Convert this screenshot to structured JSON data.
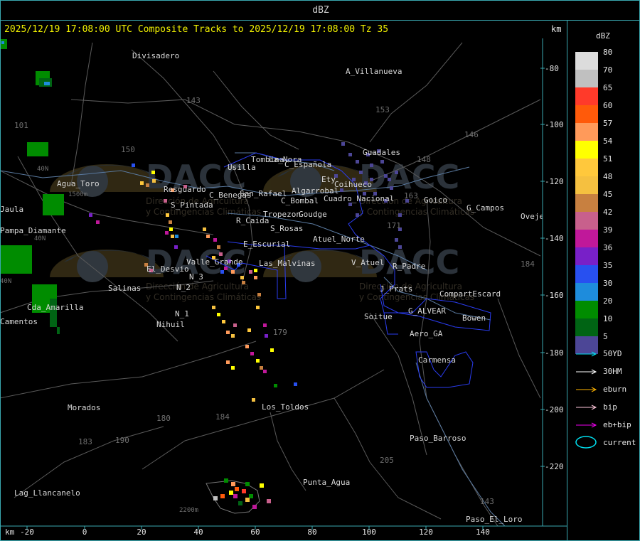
{
  "window": {
    "title": "dBZ"
  },
  "header": {
    "text": "2025/12/19 17:08:00 UTC Composite Tracks to 2025/12/19 17:08:00 Tz 35",
    "km_label": "km"
  },
  "axes": {
    "x_label": "km",
    "x_ticks": [
      "-20",
      "0",
      "20",
      "40",
      "60",
      "80",
      "100",
      "120",
      "140"
    ],
    "y_ticks": [
      "-80",
      "-100",
      "-120",
      "-140",
      "-160",
      "-180",
      "-200",
      "-220"
    ]
  },
  "legend": {
    "title": "dBZ",
    "levels": [
      {
        "label": "80",
        "color": "#dcdcdc"
      },
      {
        "label": "70",
        "color": "#c0c0c0"
      },
      {
        "label": "65",
        "color": "#ff3a2a"
      },
      {
        "label": "60",
        "color": "#ff5a0a"
      },
      {
        "label": "57",
        "color": "#ff9a5a"
      },
      {
        "label": "54",
        "color": "#ffff00"
      },
      {
        "label": "51",
        "color": "#ffc83c"
      },
      {
        "label": "48",
        "color": "#f5c040"
      },
      {
        "label": "45",
        "color": "#c88040"
      },
      {
        "label": "42",
        "color": "#c8608c"
      },
      {
        "label": "39",
        "color": "#c0189a"
      },
      {
        "label": "36",
        "color": "#7820c8"
      },
      {
        "label": "35",
        "color": "#2850f0"
      },
      {
        "label": "30",
        "color": "#1e8cdc"
      },
      {
        "label": "20",
        "color": "#008c00"
      },
      {
        "label": "10",
        "color": "#006414"
      },
      {
        "label": "5",
        "color": "#4c4696"
      }
    ],
    "tracks": [
      {
        "label": "50YD",
        "color": "#00e0f0"
      },
      {
        "label": "30HM",
        "color": "#ffffff"
      },
      {
        "label": "eburn",
        "color": "#ffb400"
      },
      {
        "label": "bip",
        "color": "#ffc8dc"
      },
      {
        "label": "eb+bip",
        "color": "#f000f0"
      }
    ],
    "current_label": "current",
    "current_color": "#00e0f0"
  },
  "map": {
    "watermarks": [
      {
        "brand": "DACC",
        "line1": "Dirección de Agricultura",
        "line2": "y Contingencias Climáticas"
      }
    ],
    "places": [
      "Divisadero",
      "A_Villanueva",
      "Guadales",
      "La_Nora",
      "C_Española",
      "Usilla",
      "Tombina",
      "San_Rafael",
      "C_Benegas",
      "C_Bombal",
      "Algarrobal",
      "Tropezon",
      "Goudge",
      "Cuadro_Nacional",
      "Resguardo",
      "S_Pintada",
      "R_Caida",
      "S_Rosas",
      "Atuel_Norte",
      "E_Escurial",
      "Valle_Grande",
      "El_Desvio",
      "Las_Malvinas",
      "V_Atuel",
      "R_Padre",
      "J_Prats",
      "CompartEscard",
      "G_ALVEAR",
      "Bowen",
      "Soitue",
      "Aero_GA",
      "Carmensa",
      "Los_Toldos",
      "Morados",
      "Paso_Barroso",
      "Punta_Agua",
      "Lag_Llancanelo",
      "Paso_El_Loro",
      "Salinas",
      "Nihuil",
      "N_1",
      "N_2",
      "N_3",
      "Cda_Amarilla",
      "Pampa_Diamante",
      "Agua_Toro",
      "Goico",
      "G_Campos",
      "Ovejeria",
      "Jaula",
      "Camentos",
      "Ety",
      "Coihueco"
    ],
    "routes": [
      "143",
      "153",
      "146",
      "148",
      "101",
      "150",
      "163",
      "171",
      "179",
      "180",
      "184",
      "183",
      "190",
      "205",
      "184",
      "143"
    ],
    "elevations": [
      "1500m",
      "2200m",
      "40N",
      "40N",
      "40N"
    ]
  }
}
